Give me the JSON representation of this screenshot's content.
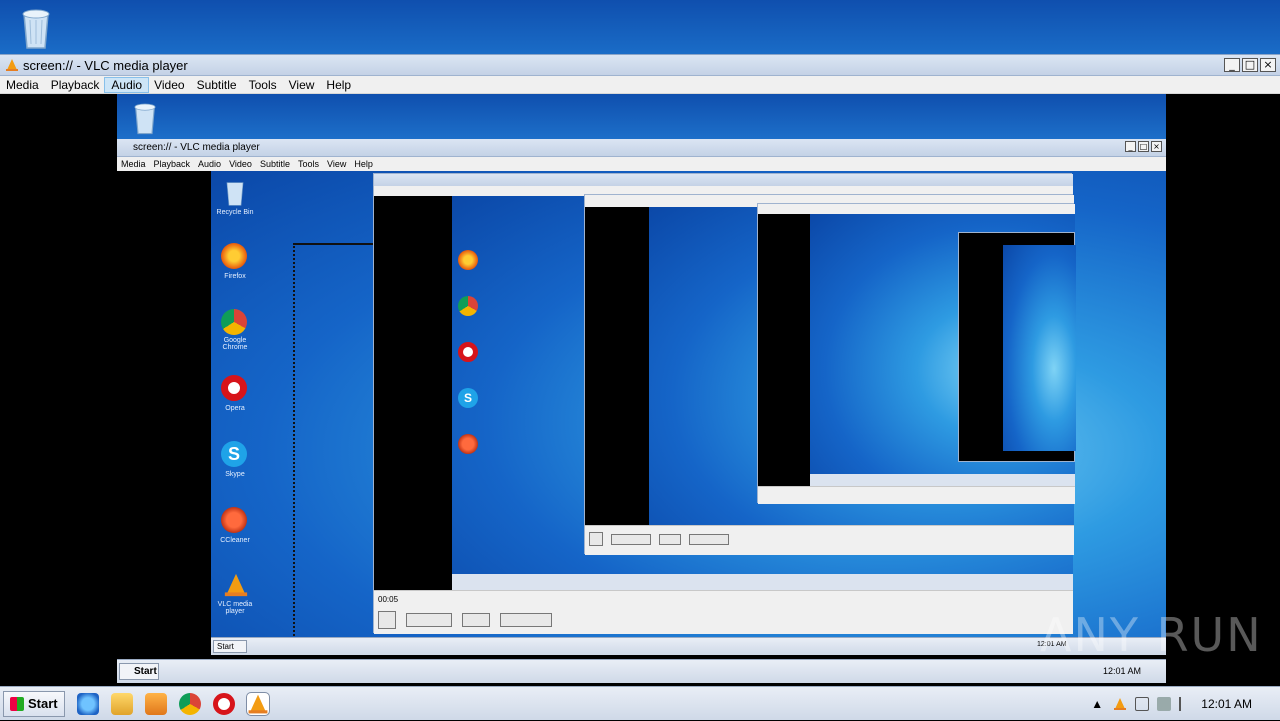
{
  "window": {
    "title": "screen:// - VLC media player",
    "controls": [
      "_",
      "□",
      "×"
    ]
  },
  "menu": [
    "Media",
    "Playback",
    "Audio",
    "Video",
    "Subtitle",
    "Tools",
    "View",
    "Help"
  ],
  "menu_highlighted": "Audio",
  "nested": {
    "title": "screen:// - VLC media player",
    "menu": [
      "Media",
      "Playback",
      "Audio",
      "Video",
      "Subtitle",
      "Tools",
      "View",
      "Help"
    ],
    "desktop_icons": [
      "Recycle Bin",
      "Firefox",
      "Google Chrome",
      "Opera",
      "Skype",
      "CCleaner",
      "VLC media player"
    ],
    "time": "00:05",
    "clock": "12:01 AM"
  },
  "taskbar": {
    "start_label": "Start",
    "pinned_icons": [
      "ie-icon",
      "explorer-icon",
      "media-player-icon",
      "chrome-icon",
      "opera-icon",
      "vlc-icon"
    ],
    "clock": "12:01 AM"
  },
  "watermark": "ANY RUN",
  "colors": {
    "accent": "#f39c12",
    "desktop": "#1565c8",
    "taskbar": "#dbe3ef"
  }
}
